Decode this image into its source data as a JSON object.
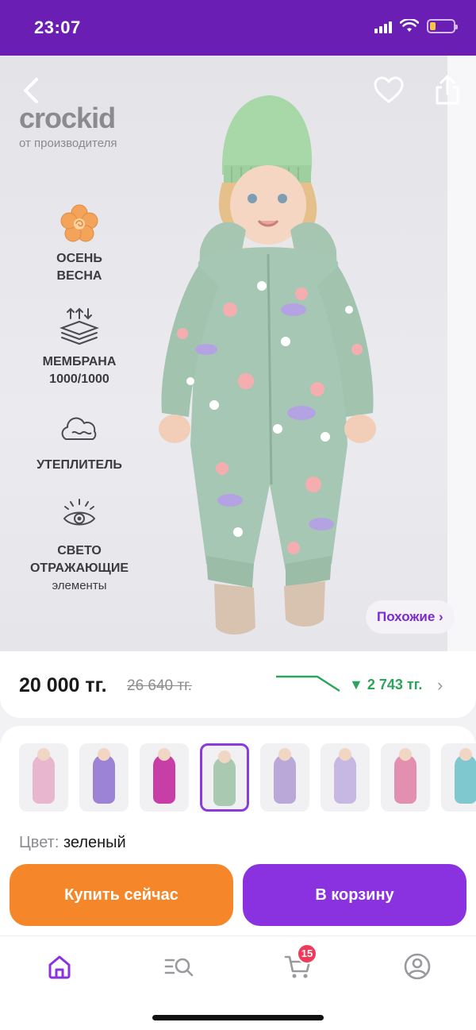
{
  "status_bar": {
    "time": "23:07",
    "battery_level": 0.25
  },
  "product_image": {
    "brand": "crockid",
    "brand_subtitle": "от производителя",
    "features": [
      {
        "icon": "flower-icon",
        "line1": "ОСЕНЬ",
        "line2": "ВЕСНА",
        "line3": ""
      },
      {
        "icon": "membrane-icon",
        "line1": "МЕМБРАНА",
        "line2": "1000/1000",
        "line3": ""
      },
      {
        "icon": "cloud-icon",
        "line1": "УТЕПЛИТЕЛЬ",
        "line2": "",
        "line3": ""
      },
      {
        "icon": "eye-icon",
        "line1": "СВЕТО",
        "line2": "ОТРАЖАЮЩИЕ",
        "line3": "элементы"
      }
    ],
    "similar_label": "Похожие ›"
  },
  "price": {
    "current": "20 000 тг.",
    "old": "26 640 тг.",
    "drop": "▼ 2 743 тг."
  },
  "variants": {
    "selected_index": 3,
    "colors": [
      "#e9b6cf",
      "#9c83d6",
      "#c73fa6",
      "#a9c9b1",
      "#b9a8d8",
      "#c6b8e2",
      "#e38fb0",
      "#7fc8cf"
    ],
    "color_label": "Цвет:",
    "color_value": "зеленый"
  },
  "actions": {
    "buy_now": "Купить сейчас",
    "add_to_cart": "В корзину"
  },
  "bottom_nav": {
    "items": [
      "home-icon",
      "catalog-search-icon",
      "cart-icon",
      "profile-icon"
    ],
    "cart_badge": "15",
    "accent": "#8b32e0"
  }
}
